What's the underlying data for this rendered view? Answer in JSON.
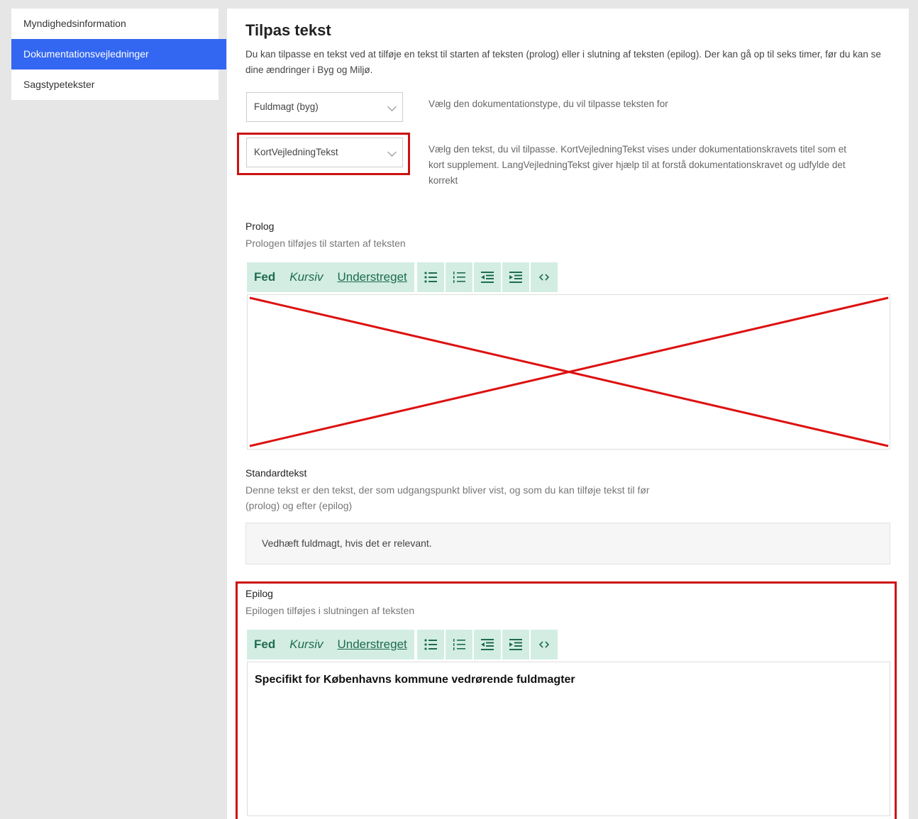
{
  "sidebar": {
    "items": [
      {
        "label": "Myndighedsinformation",
        "active": false
      },
      {
        "label": "Dokumentationsvejledninger",
        "active": true
      },
      {
        "label": "Sagstypetekster",
        "active": false
      }
    ]
  },
  "main": {
    "title": "Tilpas tekst",
    "intro": "Du kan tilpasse en tekst ved at tilføje en tekst til starten af teksten (prolog) eller i slutning af teksten (epilog). Der kan gå op til seks timer, før du kan se dine ændringer i Byg og Miljø.",
    "doc_type_select": {
      "value": "Fuldmagt (byg)",
      "hint": "Vælg den dokumentationstype, du vil tilpasse teksten for"
    },
    "text_select": {
      "value": "KortVejledningTekst",
      "hint": "Vælg den tekst, du vil tilpasse. KortVejledningTekst vises under dokumentationskravets titel som et kort supplement. LangVejledningTekst giver hjælp til at forstå dokumentationskravet og udfylde det korrekt"
    },
    "prolog": {
      "label": "Prolog",
      "sub": "Prologen tilføjes til starten af teksten"
    },
    "standard": {
      "label": "Standardtekst",
      "sub": "Denne tekst er den tekst, der som udgangspunkt bliver vist, og som du kan tilføje tekst til før (prolog) og efter (epilog)",
      "text": "Vedhæft fuldmagt, hvis det er relevant."
    },
    "epilog": {
      "label": "Epilog",
      "sub": "Epilogen tilføjes i slutningen af teksten",
      "content": "Specifikt for Københavns kommune vedrørende fuldmagter"
    },
    "toolbar": {
      "bold": "Fed",
      "italic": "Kursiv",
      "underline": "Understreget",
      "icons": [
        "bullet-list-icon",
        "numbered-list-icon",
        "outdent-icon",
        "indent-icon",
        "code-icon"
      ]
    },
    "colors": {
      "accent": "#3367f2",
      "toolbar_bg": "#d3ede2",
      "highlight": "#cc1111"
    }
  }
}
